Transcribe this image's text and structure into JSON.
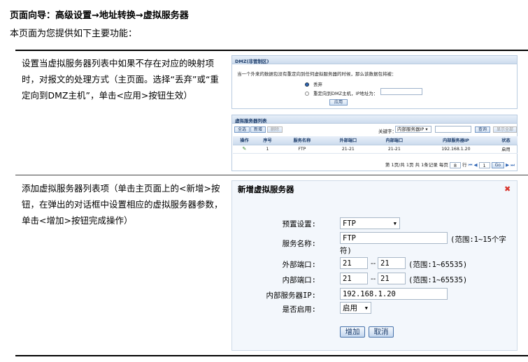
{
  "page": {
    "heading": "页面向导：高级设置→地址转换→虚拟服务器",
    "intro": "本页面为您提供如下主要功能：",
    "rows": [
      {
        "description": "设置当虚拟服务器列表中如果不存在对应的映射项时，对报文的处理方式（主页面。选择“丢弃”或“重定向到DMZ主机”，单击<应用>按钮生效）"
      },
      {
        "description": "添加虚拟服务器列表项（单击主页面上的<新增>按钮，在弹出的对话框中设置相应的虚拟服务器参数，单击<增加>按钮完成操作）"
      }
    ]
  },
  "dmz_panel": {
    "title": "DMZ(非管制区)",
    "question": "当一个外来的数据包没有重定向到任何虚拟服务器的时候，那么该数据包将被：",
    "option_drop": "丢弃",
    "option_redirect": "重定向到DMZ主机，IP地址为：",
    "apply_label": "应用"
  },
  "vs_list": {
    "title": "虚拟服务器列表",
    "btn_select_all": "全选",
    "btn_new": "新增",
    "btn_delete": "删除",
    "keyword_label": "关键字：",
    "keyword_select": "内部服务器IP",
    "btn_search": "查询",
    "btn_show_all": "显示全部",
    "columns": [
      "操作",
      "序号",
      "服务名称",
      "外部端口",
      "内部端口",
      "内部服务器IP",
      "状态"
    ],
    "rows": [
      {
        "index": "1",
        "service": "FTP",
        "ext_port": "21-21",
        "int_port": "21-21",
        "ip": "192.168.1.20",
        "status": "启用"
      }
    ],
    "pager": {
      "text": "第 1页/共 1页 共 1条记录 每页",
      "per_page": "8",
      "go_text": "行",
      "page_input": "1",
      "go_label": "Go"
    }
  },
  "dialog": {
    "title": "新增虚拟服务器",
    "preset_label": "预置设置:",
    "preset_value": "FTP",
    "service_label": "服务名称:",
    "service_value": "FTP",
    "service_hint_1": "(范围:1~15个字",
    "service_hint_2": "符)",
    "ext_label": "外部端口:",
    "ext_from": "21",
    "ext_to": "21",
    "port_sep": "--",
    "port_hint": "(范围:1~65535)",
    "int_label": "内部端口:",
    "int_from": "21",
    "int_to": "21",
    "ip_label": "内部服务器IP:",
    "ip_value": "192.168.1.20",
    "enable_label": "是否启用:",
    "enable_value": "启用",
    "add_label": "增加",
    "cancel_label": "取消"
  },
  "icons": [
    "edit-icon",
    "close-icon",
    "chevron-down-icon",
    "first-page-icon",
    "prev-page-icon",
    "next-page-icon",
    "last-page-icon"
  ]
}
